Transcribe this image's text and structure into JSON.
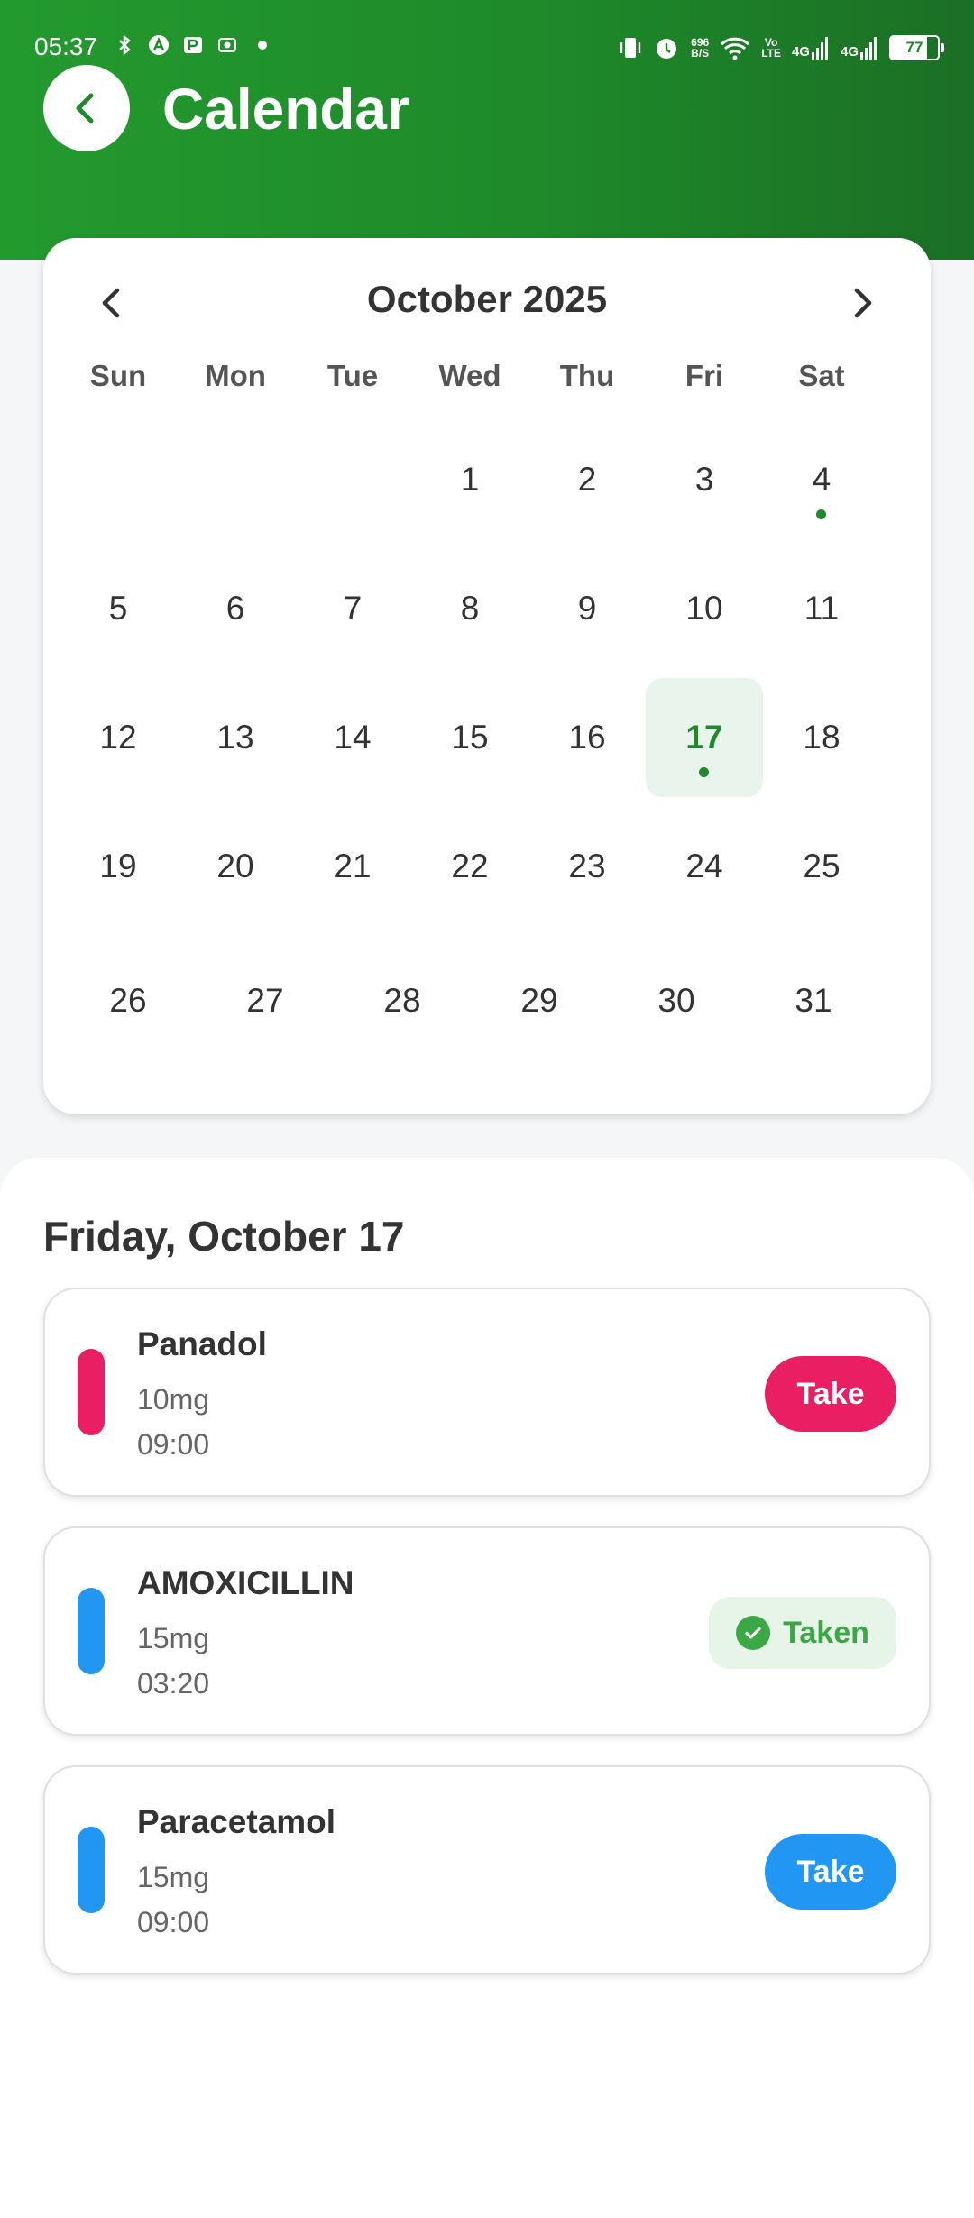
{
  "status_bar": {
    "time": "05:37",
    "net_speed_value": "696",
    "net_speed_unit": "B/S",
    "volte_top": "Vo",
    "volte_bottom": "LTE",
    "signal1": "4G",
    "signal2": "4G",
    "battery": "77"
  },
  "header": {
    "title": "Calendar",
    "back_icon": "chevron-left-icon"
  },
  "calendar": {
    "month_label": "October 2025",
    "prev_icon": "chevron-left-icon",
    "next_icon": "chevron-right-icon",
    "weekdays": [
      "Sun",
      "Mon",
      "Tue",
      "Wed",
      "Thu",
      "Fri",
      "Sat"
    ],
    "weeks": [
      [
        "",
        "",
        "",
        "1",
        "2",
        "3",
        "4"
      ],
      [
        "5",
        "6",
        "7",
        "8",
        "9",
        "10",
        "11"
      ],
      [
        "12",
        "13",
        "14",
        "15",
        "16",
        "17",
        "18"
      ],
      [
        "19",
        "20",
        "21",
        "22",
        "23",
        "24",
        "25"
      ],
      [
        "26",
        "27",
        "28",
        "29",
        "30",
        "31"
      ]
    ],
    "selected_day": "17",
    "days_with_events": [
      "4",
      "17"
    ],
    "accent_color": "#1e8a2a",
    "selected_bg": "#e9f5ec"
  },
  "schedule": {
    "date_heading": "Friday, October 17",
    "medications": [
      {
        "name": "Panadol",
        "dose": "10mg",
        "time": "09:00",
        "color": "#e91e63",
        "status": "take",
        "action_label": "Take"
      },
      {
        "name": "AMOXICILLIN",
        "dose": "15mg",
        "time": "03:20",
        "color": "#2196f3",
        "status": "taken",
        "action_label": "Taken"
      },
      {
        "name": "Paracetamol",
        "dose": "15mg",
        "time": "09:00",
        "color": "#2196f3",
        "status": "take",
        "action_label": "Take"
      }
    ]
  }
}
